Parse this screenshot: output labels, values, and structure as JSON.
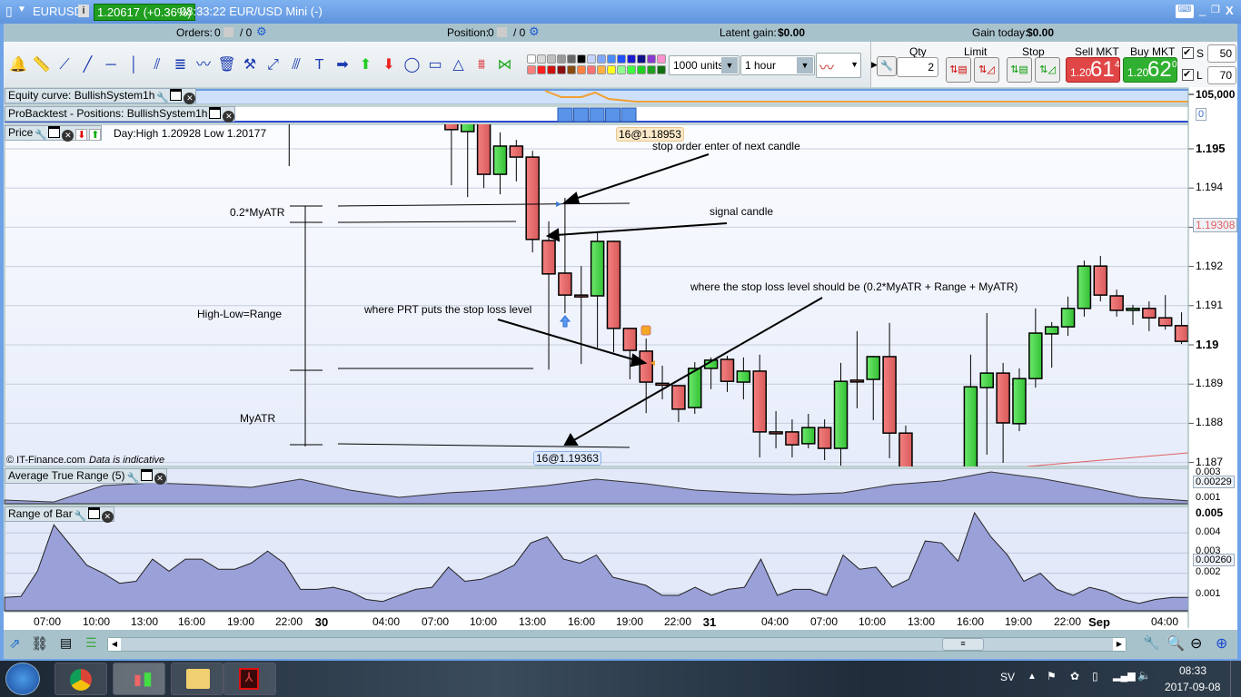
{
  "titlebar": {
    "instrument": "EURUSD",
    "price_badge": "1.20617 (+0.36%)",
    "badge_color": "#1f9e1f",
    "time_label": "08:33:22 EUR/USD Mini (-)",
    "info_icon": "i"
  },
  "infobar": {
    "orders_label": "Orders:",
    "orders_value": "0",
    "orders_total": "/ 0",
    "position_label": "Position:",
    "position_value": "0",
    "position_total": "/ 0",
    "latent_label": "Latent gain:",
    "latent_value": "$0.00",
    "gain_today_label": "Gain today:",
    "gain_today_value": "$0.00"
  },
  "toolbar": {
    "icons": [
      "alarm-bell",
      "ruler",
      "segment",
      "line",
      "horizontal-line",
      "vertical-line",
      "parallel-channel",
      "regression-channel",
      "trend-lines",
      "delete-trash",
      "properties-tools",
      "point-line",
      "fan-lines",
      "text-box",
      "arrow-right",
      "arrow-up-green",
      "arrow-down-red",
      "ellipse",
      "rectangle",
      "triangle",
      "fibonacci-retracement",
      "fibonacci-fan"
    ],
    "colors_top": [
      "#ffffff",
      "#d9d9d9",
      "#bfbfbf",
      "#999999",
      "#666666",
      "#000000",
      "#c6d3ff",
      "#7fa8ff",
      "#4a8cff",
      "#2050ff",
      "#1a1ad0",
      "#10108a",
      "#8a3ad0",
      "#ff90d0"
    ],
    "colors_bottom": [
      "#ff7f7f",
      "#ff2020",
      "#d01010",
      "#8a1010",
      "#8a4a10",
      "#ff8040",
      "#ff7070",
      "#ffb040",
      "#ffff20",
      "#90ff90",
      "#40ff40",
      "#20d020",
      "#20a020",
      "#107010"
    ],
    "units_value": "1000 units",
    "timeframe_value": "1 hour"
  },
  "trade": {
    "qty_label": "Qty",
    "qty_value": "2",
    "limit_label": "Limit",
    "stop_label": "Stop",
    "sell_label": "Sell MKT",
    "sell_small": "1.20",
    "sell_big": "61",
    "sell_tick": "4",
    "buy_label": "Buy MKT",
    "buy_small": "1.20",
    "buy_big": "62",
    "buy_tick": "0",
    "s_label": "S",
    "s_value": "50",
    "s_checked": true,
    "l_label": "L",
    "l_value": "70",
    "l_checked": true,
    "sell_color": "#e04646",
    "buy_color": "#30b030"
  },
  "panels": {
    "equity_title": "Equity curve: BullishSystem1h",
    "equity_axis": "105,000",
    "positions_title": "ProBacktest - Positions: BullishSystem1h",
    "positions_axis": "0",
    "price_title": "Price",
    "day_range": "Day:High 1.20928 Low 1.20177",
    "atr_title": "Average True Range (5)",
    "atr_current": "0.00229",
    "atr_ticks": [
      "0.003",
      "0.001"
    ],
    "rob_title": "Range of Bar",
    "rob_current": "0.00260",
    "rob_ticks": [
      "0.005",
      "0.004",
      "0.003",
      "0.002",
      "0.001"
    ]
  },
  "price_chart": {
    "type": "candlestick",
    "current_price": "1.19308",
    "y_ticks": [
      {
        "v": 1.195,
        "label": "1.195",
        "bold": true
      },
      {
        "v": 1.194,
        "label": "1.194"
      },
      {
        "v": 1.192,
        "label": "1.192"
      },
      {
        "v": 1.191,
        "label": "1.191"
      },
      {
        "v": 1.19,
        "label": "1.19",
        "bold": true
      },
      {
        "v": 1.189,
        "label": "1.189"
      },
      {
        "v": 1.188,
        "label": "1.188"
      },
      {
        "v": 1.187,
        "label": "1.187"
      }
    ],
    "x_ticks": [
      "07:00",
      "10:00",
      "13:00",
      "16:00",
      "19:00",
      "22:00",
      "30",
      "04:00",
      "07:00",
      "10:00",
      "13:00",
      "16:00",
      "19:00",
      "22:00",
      "31",
      "04:00",
      "07:00",
      "10:00",
      "13:00",
      "16:00",
      "19:00",
      "22:00",
      "Sep",
      "04:00"
    ],
    "candles": [
      {
        "t": "29 22:00",
        "o": 1.1962,
        "h": 1.1963,
        "l": 1.19456,
        "c": 1.1961
      },
      {
        "t": "30 08:00",
        "o": 1.19567,
        "h": 1.196,
        "l": 1.19407,
        "c": 1.19549
      },
      {
        "t": "30 09:00",
        "o": 1.19544,
        "h": 1.196,
        "l": 1.19377,
        "c": 1.19567
      },
      {
        "t": "30 10:00",
        "o": 1.19567,
        "h": 1.196,
        "l": 1.194,
        "c": 1.19435
      },
      {
        "t": "30 11:00",
        "o": 1.19435,
        "h": 1.19542,
        "l": 1.19384,
        "c": 1.19507
      },
      {
        "t": "30 12:00",
        "o": 1.19507,
        "h": 1.19523,
        "l": 1.19417,
        "c": 1.19479
      },
      {
        "t": "30 13:00",
        "o": 1.19479,
        "h": 1.19495,
        "l": 1.19236,
        "c": 1.19269
      },
      {
        "t": "30 14:00",
        "o": 1.19266,
        "h": 1.19315,
        "l": 1.18937,
        "c": 1.19181
      },
      {
        "t": "30 15:00",
        "o": 1.19183,
        "h": 1.19375,
        "l": 1.19081,
        "c": 1.19127
      },
      {
        "t": "30 16:00",
        "o": 1.19127,
        "h": 1.19201,
        "l": 1.18951,
        "c": 1.19125
      },
      {
        "t": "30 17:00",
        "o": 1.19125,
        "h": 1.19285,
        "l": 1.18993,
        "c": 1.19264
      },
      {
        "t": "30 18:00",
        "o": 1.19264,
        "h": 1.19266,
        "l": 1.18981,
        "c": 1.19042
      },
      {
        "t": "30 19:00",
        "o": 1.19042,
        "h": 1.19042,
        "l": 1.18912,
        "c": 1.18986
      },
      {
        "t": "30 20:00",
        "o": 1.18984,
        "h": 1.19016,
        "l": 1.18826,
        "c": 1.18905
      },
      {
        "t": "30 21:00",
        "o": 1.18902,
        "h": 1.18947,
        "l": 1.18861,
        "c": 1.189
      },
      {
        "t": "30 22:00",
        "o": 1.18896,
        "h": 1.18896,
        "l": 1.18803,
        "c": 1.18836
      },
      {
        "t": "30 23:00",
        "o": 1.1884,
        "h": 1.18956,
        "l": 1.18824,
        "c": 1.1894
      },
      {
        "t": "31 00:00",
        "o": 1.1894,
        "h": 1.18968,
        "l": 1.18887,
        "c": 1.18961
      },
      {
        "t": "31 01:00",
        "o": 1.18963,
        "h": 1.18972,
        "l": 1.1888,
        "c": 1.18907
      },
      {
        "t": "31 02:00",
        "o": 1.18905,
        "h": 1.18968,
        "l": 1.18861,
        "c": 1.18933
      },
      {
        "t": "31 03:00",
        "o": 1.18933,
        "h": 1.18975,
        "l": 1.18713,
        "c": 1.18778
      },
      {
        "t": "31 04:00",
        "o": 1.18778,
        "h": 1.18831,
        "l": 1.18736,
        "c": 1.18776
      },
      {
        "t": "31 05:00",
        "o": 1.18778,
        "h": 1.1881,
        "l": 1.18713,
        "c": 1.18745
      },
      {
        "t": "31 06:00",
        "o": 1.18748,
        "h": 1.18824,
        "l": 1.18736,
        "c": 1.18789
      },
      {
        "t": "31 07:00",
        "o": 1.18789,
        "h": 1.1881,
        "l": 1.18706,
        "c": 1.18736
      },
      {
        "t": "31 08:00",
        "o": 1.18736,
        "h": 1.18954,
        "l": 1.18692,
        "c": 1.18907
      },
      {
        "t": "31 09:00",
        "o": 1.1891,
        "h": 1.19035,
        "l": 1.18838,
        "c": 1.18908
      },
      {
        "t": "31 10:00",
        "o": 1.18912,
        "h": 1.18972,
        "l": 1.18808,
        "c": 1.1897
      },
      {
        "t": "31 11:00",
        "o": 1.1897,
        "h": 1.19056,
        "l": 1.18711,
        "c": 1.18775
      },
      {
        "t": "31 12:00",
        "o": 1.18775,
        "h": 1.18794,
        "l": 1.1862,
        "c": 1.1866
      },
      {
        "t": "31 16:00",
        "o": 1.1865,
        "h": 1.18975,
        "l": 1.1862,
        "c": 1.18893
      },
      {
        "t": "31 17:00",
        "o": 1.18891,
        "h": 1.19081,
        "l": 1.1872,
        "c": 1.18928
      },
      {
        "t": "31 18:00",
        "o": 1.18928,
        "h": 1.18954,
        "l": 1.18699,
        "c": 1.18801
      },
      {
        "t": "31 19:00",
        "o": 1.18799,
        "h": 1.1894,
        "l": 1.1878,
        "c": 1.18914
      },
      {
        "t": "31 20:00",
        "o": 1.18914,
        "h": 1.19093,
        "l": 1.18891,
        "c": 1.1903
      },
      {
        "t": "31 21:00",
        "o": 1.19028,
        "h": 1.19058,
        "l": 1.18942,
        "c": 1.19046
      },
      {
        "t": "31 22:00",
        "o": 1.19046,
        "h": 1.19123,
        "l": 1.19023,
        "c": 1.19093
      },
      {
        "t": "31 23:00",
        "o": 1.19093,
        "h": 1.19215,
        "l": 1.19072,
        "c": 1.19201
      },
      {
        "t": "1 00:00",
        "o": 1.19201,
        "h": 1.19227,
        "l": 1.19111,
        "c": 1.19127
      },
      {
        "t": "1 01:00",
        "o": 1.19125,
        "h": 1.19141,
        "l": 1.19072,
        "c": 1.19088
      },
      {
        "t": "1 02:00",
        "o": 1.19088,
        "h": 1.19102,
        "l": 1.19051,
        "c": 1.19093
      },
      {
        "t": "1 03:00",
        "o": 1.19093,
        "h": 1.19111,
        "l": 1.19035,
        "c": 1.19069
      },
      {
        "t": "1 04:00",
        "o": 1.19069,
        "h": 1.19127,
        "l": 1.19039,
        "c": 1.19049
      },
      {
        "t": "1 05:00",
        "o": 1.19049,
        "h": 1.19083,
        "l": 1.19002,
        "c": 1.19009
      }
    ],
    "order_labels": {
      "top": "16@1.18953",
      "bottom": "16@1.19363"
    },
    "annotations": {
      "stop_order": "stop order enter of next candle",
      "signal": "signal candle",
      "prt_stop": "where PRT puts the stop loss level",
      "should_stop": "where the stop loss level should be (0.2*MyATR + Range + MyATR)",
      "atr02": "0.2*MyATR",
      "range": "High-Low=Range",
      "myatr": "MyATR"
    },
    "copyright": "© IT-Finance.com",
    "disclaimer": "Data is indicative"
  },
  "atr_series": [
    0.00086,
    0.00071,
    0.002,
    0.00221,
    0.00207,
    0.00186,
    0.0025,
    0.00164,
    0.00107,
    0.00143,
    0.00164,
    0.002,
    0.0025,
    0.00214,
    0.00164,
    0.00143,
    0.00129,
    0.00143,
    0.00207,
    0.00236,
    0.00307,
    0.00257,
    0.00186,
    0.00107,
    0.00079
  ],
  "range_of_bar_series": [
    0.0008,
    0.00085,
    0.0021,
    0.0044,
    0.0034,
    0.0024,
    0.002,
    0.0015,
    0.0016,
    0.0027,
    0.0021,
    0.0027,
    0.0027,
    0.0022,
    0.0022,
    0.0025,
    0.0031,
    0.0025,
    0.0012,
    0.0012,
    0.0013,
    0.0011,
    0.0007,
    0.0006,
    0.0009,
    0.0012,
    0.0013,
    0.0023,
    0.0016,
    0.0017,
    0.002,
    0.0024,
    0.0035,
    0.0038,
    0.0027,
    0.0025,
    0.0029,
    0.0018,
    0.0016,
    0.0014,
    0.0009,
    0.0009,
    0.0013,
    0.0009,
    0.0012,
    0.0013,
    0.0027,
    0.0009,
    0.0012,
    0.0012,
    0.0009,
    0.0029,
    0.0022,
    0.0023,
    0.0013,
    0.0017,
    0.0036,
    0.0035,
    0.0026,
    0.005,
    0.0038,
    0.0029,
    0.0016,
    0.002,
    0.0012,
    0.0009,
    0.0013,
    0.0011,
    0.0007,
    0.0005,
    0.0007,
    0.0008,
    0.0008
  ],
  "taskbar": {
    "apps": [
      "windows-start",
      "chrome",
      "prorealtime",
      "file-explorer",
      "acrobat"
    ],
    "language": "SV",
    "time": "08:33",
    "date": "2017-09-08"
  }
}
